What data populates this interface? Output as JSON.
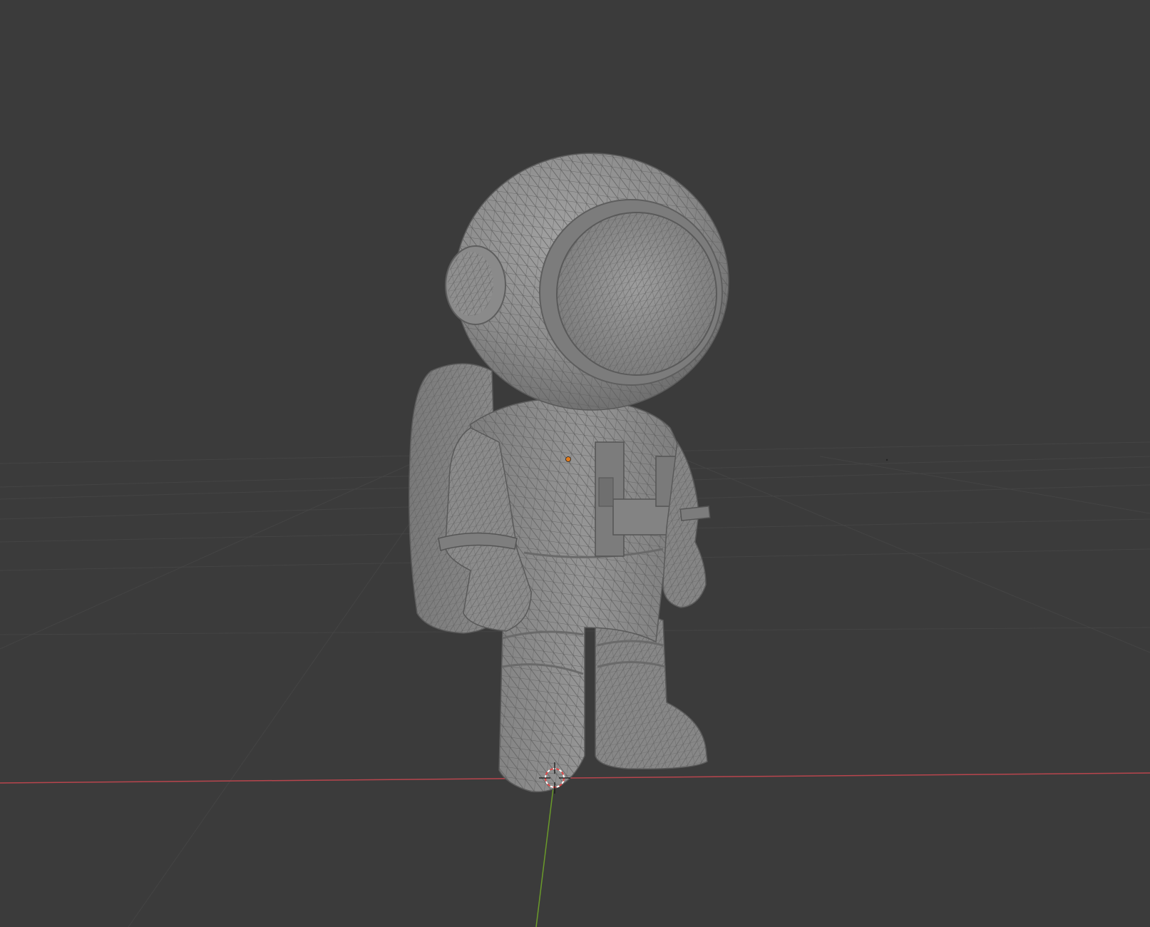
{
  "viewport": {
    "background_color": "#3b3b3b",
    "grid_line_color": "#454545",
    "x_axis_color": "#b8454d",
    "y_axis_color": "#6a9a2a",
    "model_color": "#8e8e8e",
    "wireframe_color": "#5a5a5a",
    "origin_color": "#e07a1a",
    "cursor_color": "#e04848"
  },
  "scene": {
    "object": "astronaut-model",
    "shading": "solid",
    "overlay": "wireframe",
    "icon": "3d-cursor-icon"
  }
}
